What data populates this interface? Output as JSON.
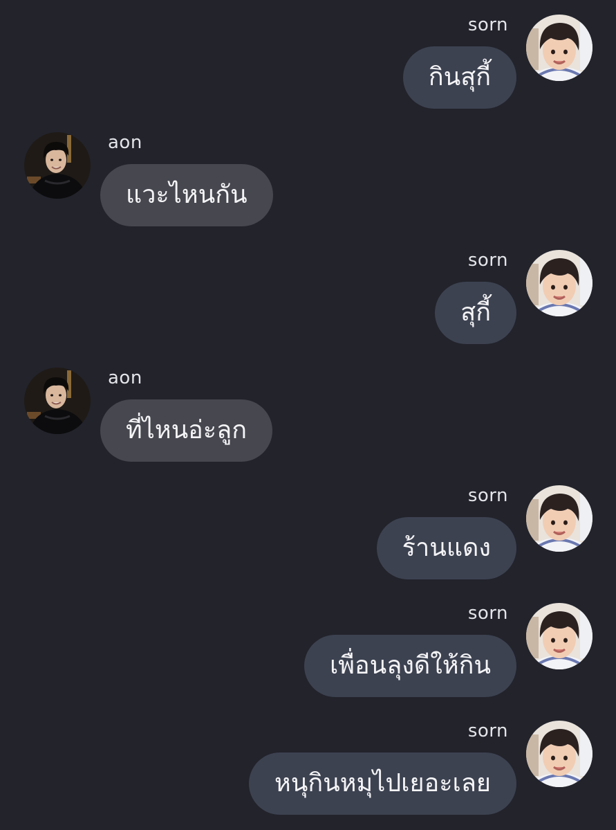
{
  "chat": {
    "messages": [
      {
        "sender": "sorn",
        "text": "กินสุกี้",
        "side": "right"
      },
      {
        "sender": "aon",
        "text": "แวะไหนกัน",
        "side": "left"
      },
      {
        "sender": "sorn",
        "text": "สุกี้",
        "side": "right"
      },
      {
        "sender": "aon",
        "text": "ที่ไหนอ่ะลูก",
        "side": "left"
      },
      {
        "sender": "sorn",
        "text": "ร้านแดง",
        "side": "right"
      },
      {
        "sender": "sorn",
        "text": "เพื่อนลุงดีให้กิน",
        "side": "right"
      },
      {
        "sender": "sorn",
        "text": "หนุกินหมุไปเยอะเลย",
        "side": "right"
      }
    ]
  },
  "colors": {
    "background": "#22232b",
    "outgoing_bubble": "#3d4251",
    "incoming_bubble": "#46474f",
    "text": "#f4f4f6"
  },
  "icons": {
    "sorn_avatar": "child-avatar-icon",
    "aon_avatar": "man-avatar-icon"
  }
}
